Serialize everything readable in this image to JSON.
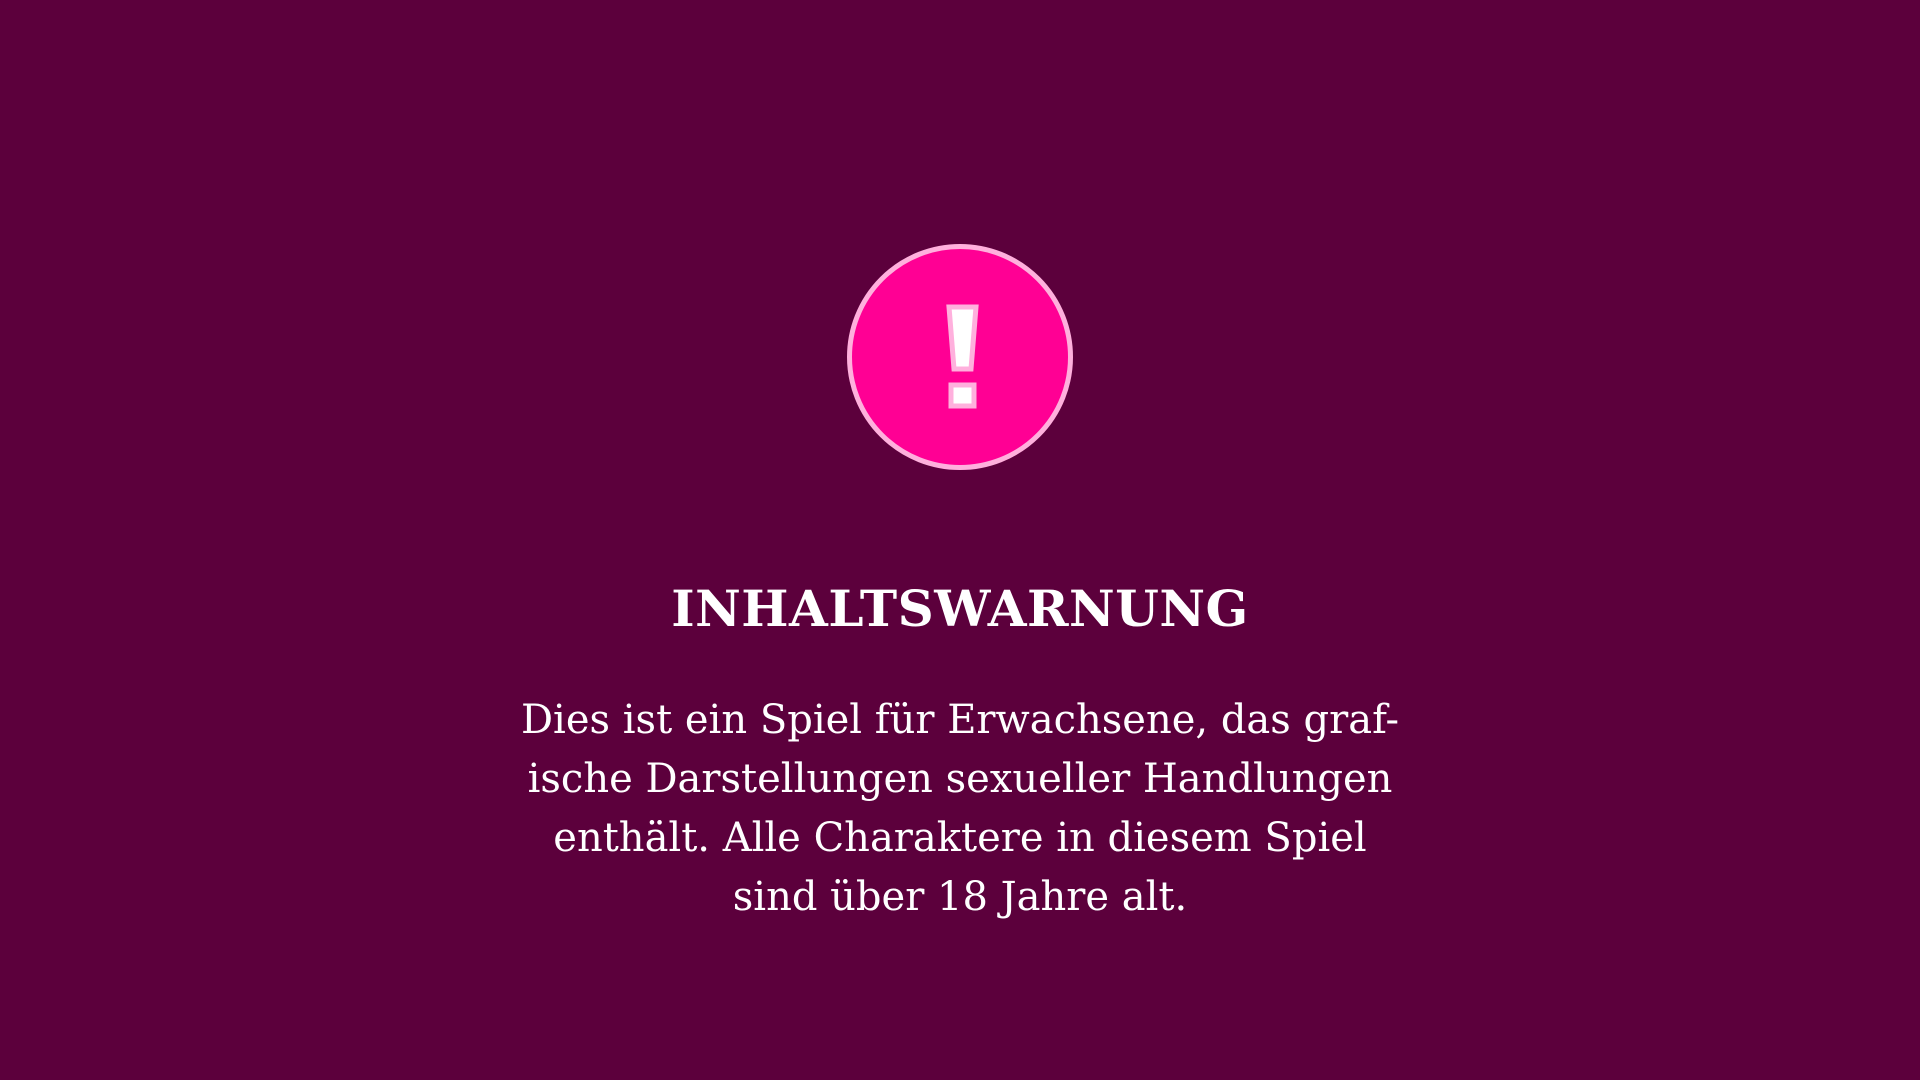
{
  "screen": {
    "background_color": "#5c003c"
  },
  "warning_icon": {
    "icon": "exclamation-icon",
    "fill_color": "#ff0094",
    "ring_color": "#ffb0dd"
  },
  "content_warning": {
    "title": "INHALTSWARNUNG",
    "lines": [
      "Dies ist ein Spiel für Erwachsene, das graf-",
      "ische Darstellungen sexueller Handlungen",
      "enthält. Alle Charaktere in diesem Spiel",
      "sind über 18 Jahre alt."
    ]
  }
}
